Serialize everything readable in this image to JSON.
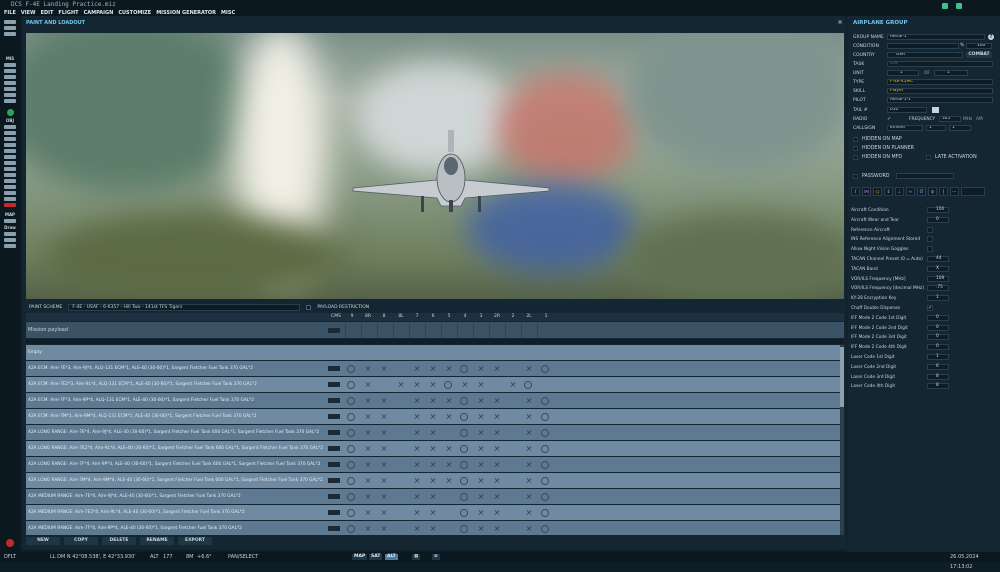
{
  "window": {
    "title": "DCS F-4E Landing Practice.miz"
  },
  "menu": [
    "FILE",
    "VIEW",
    "EDIT",
    "FLIGHT",
    "CAMPAIGN",
    "CUSTOMIZE",
    "MISSION GENERATOR",
    "MISC"
  ],
  "left_toolbar": {
    "labels": {
      "mis": "MIS",
      "obj": "OBJ",
      "map": "MAP",
      "draw": "Draw"
    }
  },
  "paint": {
    "title": "PAINT AND LOADOUT",
    "scheme_label": "PAINT SCHEME",
    "scheme_value": "F-4E - USAF - 6-6357 - Hill Two - 141st TFS Tigers",
    "payload_restriction": "PAYLOAD RESTRICTION",
    "pylon_headers": [
      "CMS",
      "9",
      "8R",
      "8",
      "8L",
      "7",
      "6",
      "5",
      "4",
      "3",
      "2R",
      "2",
      "2L",
      "1"
    ],
    "mission_payload": "Mission payload",
    "rows": [
      "Empty",
      "A2A ECM: Aim-7E*3, Aim-9J*4, ALQ-131 ECM*1, ALE-40 (30-60)*1, Sargent Fletcher Fuel Tank 370 GAL*2",
      "A2A ECM: Aim-7E2*3, Aim-9L*4, ALQ-131 ECM*1, ALE-40 (30-60)*1, Sargent Fletcher Fuel Tank 370 GAL*2",
      "A2A ECM: Aim-7F*3, Aim-9P*4, ALQ-131 ECM*1, ALE-40 (30-60)*1, Sargent Fletcher Fuel Tank 370 GAL*2",
      "A2A ECM: Aim-7M*3, Aim-9M*4, ALQ-131 ECM*1, ALE-40 (30-60)*1, Sargent Fletcher Fuel Tank 370 GAL*2",
      "A2A LONG RANGE: Aim-7E*4, Aim-9J*4, ALE-40 (30-60)*1, Sargent Fletcher Fuel Tank 600 GAL*1, Sargent Fletcher Fuel Tank 370 GAL*2",
      "A2A LONG RANGE: Aim-7E2*4, Aim-9L*4, ALE-40 (30-60)*1, Sargent Fletcher Fuel Tank 600 GAL*1, Sargent Fletcher Fuel Tank 370 GAL*2",
      "A2A LONG RANGE: Aim-7F*4, Aim-9P*4, ALE-40 (30-60)*1, Sargent Fletcher Fuel Tank 600 GAL*1, Sargent Fletcher Fuel Tank 370 GAL*2",
      "A2A LONG RANGE: Aim-7M*4, Aim-9M*4, ALE-40 (30-60)*1, Sargent Fletcher Fuel Tank 600 GAL*1, Sargent Fletcher Fuel Tank 370 GAL*2",
      "A2A MEDIUM RANGE: Aim-7E*4, Aim-9J*4, ALE-40 (30-60)*1, Sargent Fletcher Fuel Tank 370 GAL*2",
      "A2A MEDIUM RANGE: Aim-7E2*4, Aim-9L*4, ALE-40 (30-60)*1, Sargent Fletcher Fuel Tank 370 GAL*2",
      "A2A MEDIUM RANGE: Aim-7F*4, Aim-9P*4, ALE-40 (30-60)*1, Sargent Fletcher Fuel Tank 370 GAL*2"
    ],
    "buttons": {
      "new": "NEW",
      "copy": "COPY",
      "delete": "DELETE",
      "rename": "RENAME",
      "export": "EXPORT"
    }
  },
  "status": {
    "mode": "DFLT",
    "coords": "LL DM  N 42°08.538', E 42°33.930'",
    "alt_label": "ALT",
    "alt_value": "177",
    "dist": "8M",
    "temp": "+6.6°",
    "action": "PAN/SELECT",
    "map_btn": "MAP",
    "sat_btn": "SAT",
    "alt_btn": "ALT",
    "datetime": "26.05.2024 17:13:02"
  },
  "group": {
    "title": "AIRPLANE GROUP",
    "group_name_label": "GROUP NAME",
    "group_name": "Aerial-1",
    "condition_label": "CONDITION",
    "condition_value": "100",
    "country_label": "COUNTRY",
    "country_value": "USA",
    "combat_btn": "COMBAT",
    "task_label": "TASK",
    "task_value": "CAP",
    "unit_label": "UNIT",
    "unit_value": "1",
    "unit_of": "OF",
    "unit_total": "1",
    "type_label": "TYPE",
    "type_value": "F-4E-45MC",
    "skill_label": "SKILL",
    "skill_value": "Player",
    "pilot_label": "PILOT",
    "pilot_value": "Aerial-1-1",
    "tail_label": "TAIL #",
    "tail_value": "010",
    "radio_label": "RADIO",
    "freq_label": "FREQUENCY",
    "freq_value": "305",
    "freq_unit": "MHz",
    "freq_mod": "AM",
    "callsign_label": "CALLSIGN",
    "callsign_value": "Enfield",
    "callsign_n1": "1",
    "callsign_n2": "1",
    "hidden_map": "HIDDEN ON MAP",
    "hidden_planner": "HIDDEN ON PLANNER",
    "hidden_mfd": "HIDDEN ON MFD",
    "late_activation": "LATE ACTIVATION",
    "password": "PASSWORD"
  },
  "aircraft_props": [
    {
      "label": "Aircraft Condition",
      "value": "100",
      "kind": "num"
    },
    {
      "label": "Aircraft Wear and Tear",
      "value": "0",
      "kind": "num"
    },
    {
      "label": "Reference Aircraft",
      "value": "",
      "kind": "chk"
    },
    {
      "label": "INS Reference Alignment Stored",
      "value": "",
      "kind": "chk"
    },
    {
      "label": "Allow Night Vision Goggles",
      "value": "",
      "kind": "chk"
    },
    {
      "label": "TACAN Channel Preset (0 = Auto)",
      "value": "44",
      "kind": "num"
    },
    {
      "label": "TACAN Band",
      "value": "X",
      "kind": "num"
    },
    {
      "label": "VOR/ILS Frequency [MHz]",
      "value": "109",
      "kind": "num"
    },
    {
      "label": "VOR/ILS Frequency [decimal MHz]",
      "value": ".75",
      "kind": "num"
    },
    {
      "label": "KY-28 Encryption Key",
      "value": "1",
      "kind": "num"
    },
    {
      "label": "Chaff Double Dispense",
      "value": "✓",
      "kind": "chk"
    },
    {
      "label": "IFF Mode 2 Code 1st Digit",
      "value": "0",
      "kind": "num"
    },
    {
      "label": "IFF Mode 2 Code 2nd Digit",
      "value": "0",
      "kind": "num"
    },
    {
      "label": "IFF Mode 2 Code 3rd Digit",
      "value": "0",
      "kind": "num"
    },
    {
      "label": "IFF Mode 2 Code 4th Digit",
      "value": "0",
      "kind": "num"
    },
    {
      "label": "Laser Code 1st Digit",
      "value": "1",
      "kind": "num"
    },
    {
      "label": "Laser Code 2nd Digit",
      "value": "6",
      "kind": "num"
    },
    {
      "label": "Laser Code 3rd Digit",
      "value": "8",
      "kind": "num"
    },
    {
      "label": "Laser Code 4th Digit",
      "value": "8",
      "kind": "num"
    }
  ],
  "colors": {
    "accent": "#6fc6e8",
    "skill": "#e8c52a",
    "danger": "#c02a2a"
  }
}
